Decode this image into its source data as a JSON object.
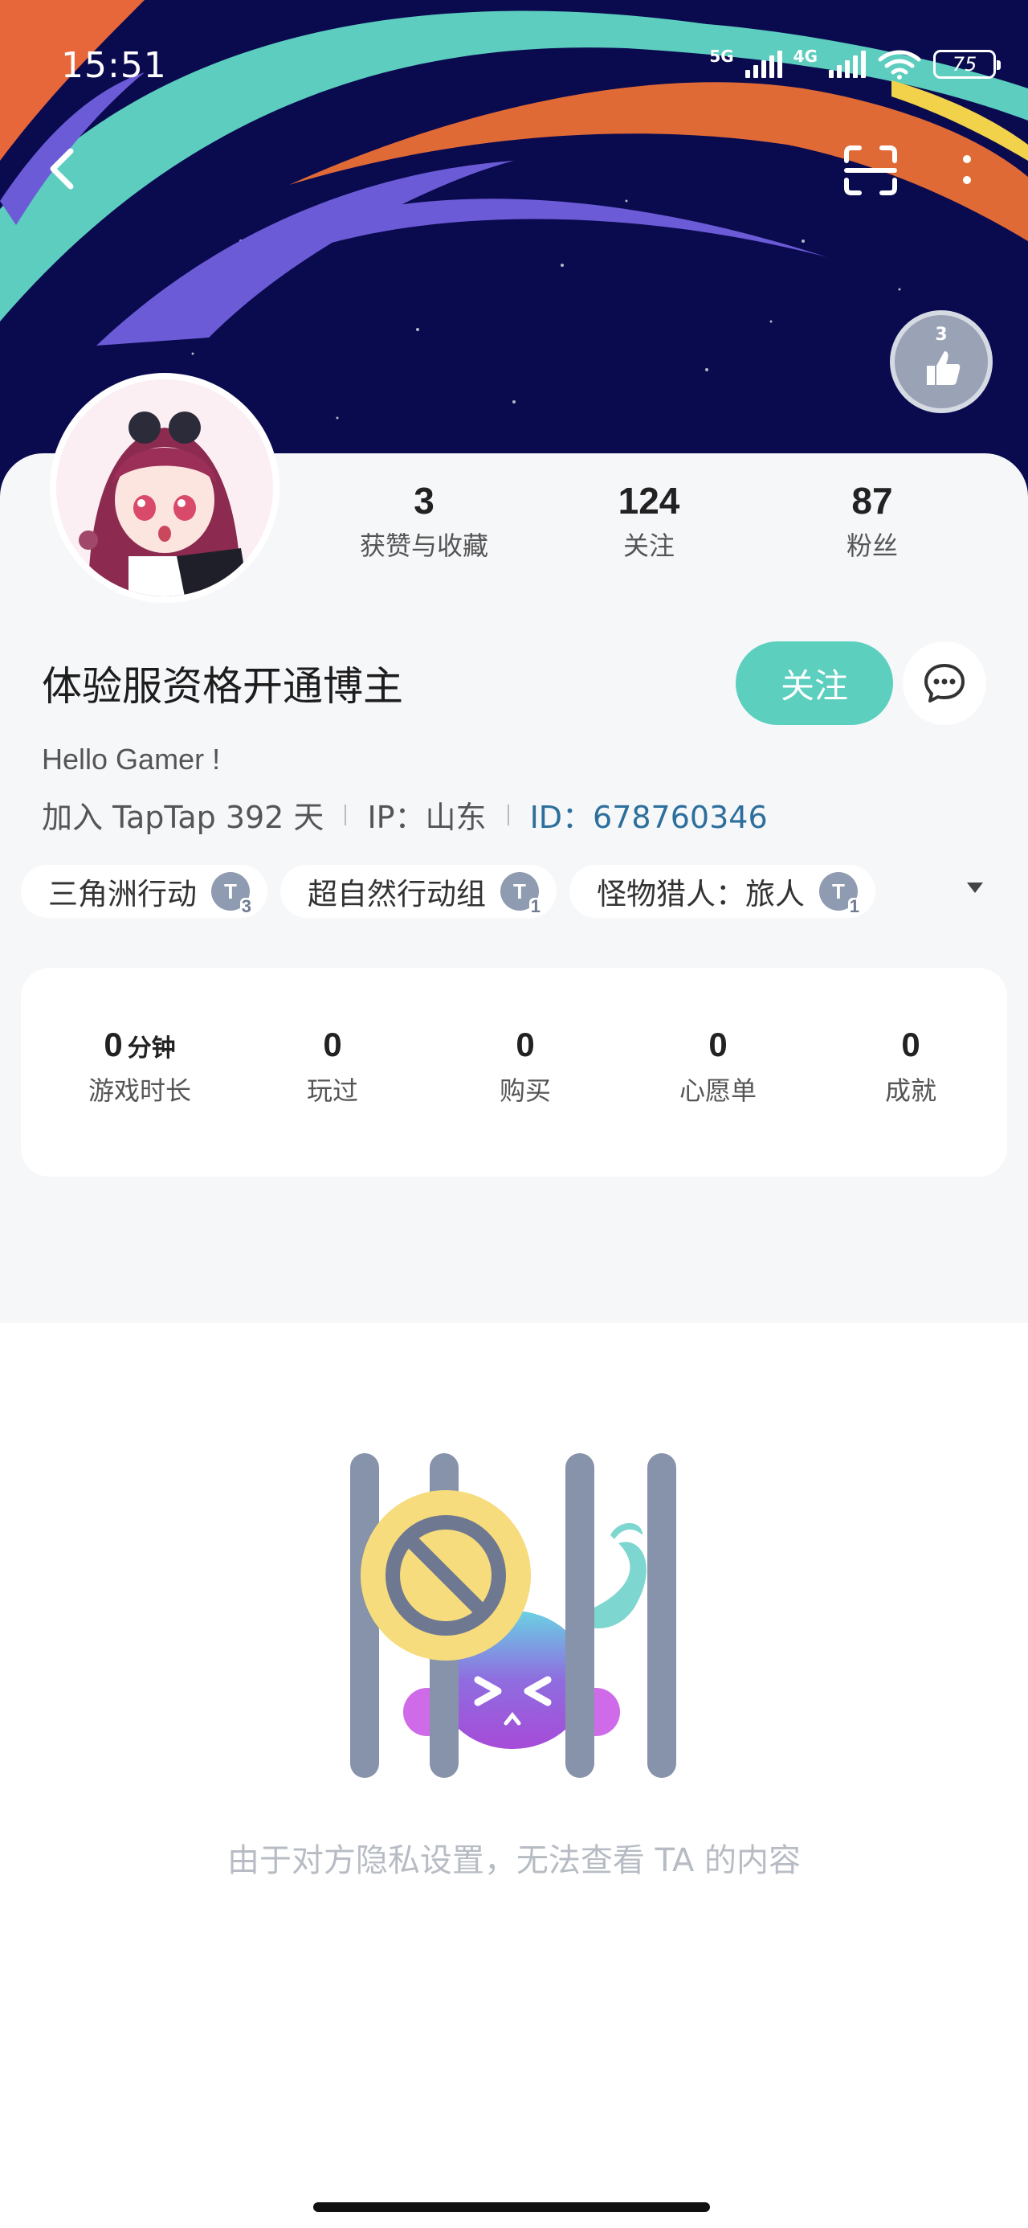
{
  "status_bar": {
    "time": "15:51",
    "network_5g": "5G",
    "network_4g": "4G",
    "battery": "75"
  },
  "header": {
    "back_icon": "chevron-left-icon",
    "scan_icon": "scan-icon",
    "more_icon": "more-vertical-icon",
    "medal_count": "3"
  },
  "profile": {
    "stats": [
      {
        "value": "3",
        "label": "获赞与收藏"
      },
      {
        "value": "124",
        "label": "关注"
      },
      {
        "value": "87",
        "label": "粉丝"
      }
    ],
    "name": "体验服资格开通博主",
    "follow_label": "关注",
    "bio": "Hello Gamer !",
    "joined": "加入 TapTap 392 天",
    "ip": "IP：山东",
    "id": "ID：678760346"
  },
  "tags": [
    {
      "name": "三角洲行动",
      "level": "3"
    },
    {
      "name": "超自然行动组",
      "level": "1"
    },
    {
      "name": "怪物猎人：旅人",
      "level": "1"
    }
  ],
  "game_stats": [
    {
      "value": "0",
      "unit": "分钟",
      "label": "游戏时长"
    },
    {
      "value": "0",
      "unit": "",
      "label": "玩过"
    },
    {
      "value": "0",
      "unit": "",
      "label": "购买"
    },
    {
      "value": "0",
      "unit": "",
      "label": "心愿单"
    },
    {
      "value": "0",
      "unit": "",
      "label": "成就"
    }
  ],
  "empty_state": {
    "message": "由于对方隐私设置，无法查看 TA 的内容"
  },
  "colors": {
    "accent": "#5ccfbf",
    "id_link": "#2d6f9c",
    "banner_bg": "#0a0a4f"
  }
}
